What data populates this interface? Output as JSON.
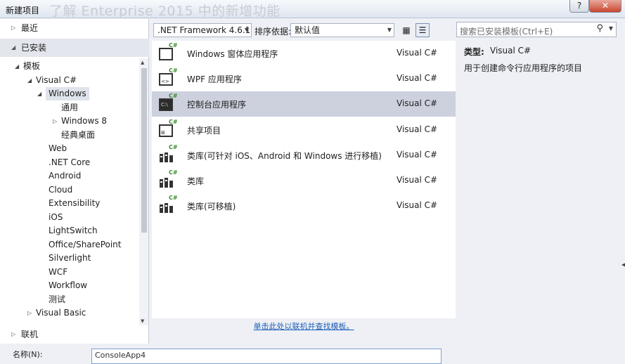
{
  "window": {
    "title": "新建项目",
    "ghost_title": "了解 Enterprise 2015 中的新增功能",
    "help_label": "?",
    "close_label": "✕"
  },
  "left": {
    "recent_label": "最近",
    "installed_label": "已安装",
    "online_label": "联机",
    "tree": [
      {
        "label": "模板",
        "level": 0,
        "expanded": true
      },
      {
        "label": "Visual C#",
        "level": 1,
        "expanded": true
      },
      {
        "label": "Windows",
        "level": 2,
        "expanded": true,
        "selected": true
      },
      {
        "label": "通用",
        "level": 3
      },
      {
        "label": "Windows 8",
        "level": 3,
        "collapsed": true
      },
      {
        "label": "经典桌面",
        "level": 3
      },
      {
        "label": "Web",
        "level": 2
      },
      {
        "label": ".NET Core",
        "level": 2
      },
      {
        "label": "Android",
        "level": 2
      },
      {
        "label": "Cloud",
        "level": 2
      },
      {
        "label": "Extensibility",
        "level": 2
      },
      {
        "label": "iOS",
        "level": 2
      },
      {
        "label": "LightSwitch",
        "level": 2
      },
      {
        "label": "Office/SharePoint",
        "level": 2
      },
      {
        "label": "Silverlight",
        "level": 2
      },
      {
        "label": "WCF",
        "level": 2
      },
      {
        "label": "Workflow",
        "level": 2
      },
      {
        "label": "测试",
        "level": 2
      },
      {
        "label": "Visual Basic",
        "level": 1,
        "collapsed": true
      }
    ]
  },
  "toolbar": {
    "framework": ".NET Framework 4.6.1",
    "sort_label": "排序依据:",
    "sort_value": "默认值"
  },
  "templates": [
    {
      "name": "Windows 窗体应用程序",
      "lang": "Visual C#",
      "icon": "winforms-icon",
      "sub": ""
    },
    {
      "name": "WPF 应用程序",
      "lang": "Visual C#",
      "icon": "wpf-icon",
      "sub": "<>"
    },
    {
      "name": "控制台应用程序",
      "lang": "Visual C#",
      "icon": "console-icon",
      "sub": "C:\\",
      "selected": true
    },
    {
      "name": "共享项目",
      "lang": "Visual C#",
      "icon": "shared-project-icon",
      "sub": "⊞"
    },
    {
      "name": "类库(可针对 iOS、Android 和 Windows 进行移植)",
      "lang": "Visual C#",
      "icon": "portable-library-icon",
      "sub": ""
    },
    {
      "name": "类库",
      "lang": "Visual C#",
      "icon": "class-library-icon",
      "sub": ""
    },
    {
      "name": "类库(可移植)",
      "lang": "Visual C#",
      "icon": "portable-class-library-icon",
      "sub": ""
    }
  ],
  "icon_tag": "C#",
  "online_link": "单击此处以联机并查找模板。",
  "search": {
    "placeholder": "搜索已安装模板(Ctrl+E)"
  },
  "detail": {
    "type_label": "类型:",
    "type_value": "Visual C#",
    "description": "用于创建命令行应用程序的项目"
  },
  "bottom": {
    "name_label": "名称(N):",
    "name_value": "ConsoleApp4"
  },
  "colors": {
    "selection": "#cdd1de",
    "link": "#1d5fb8",
    "csharp_tag": "#3a8a2a",
    "close_button": "#c8462f"
  }
}
